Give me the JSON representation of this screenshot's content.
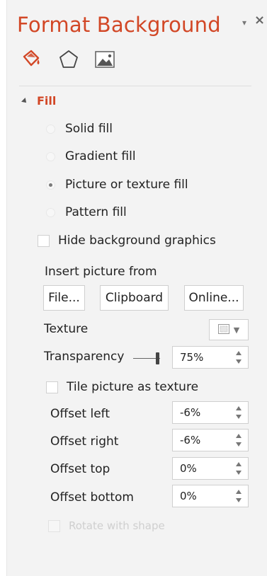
{
  "pane": {
    "title": "Format Background",
    "pin_glyph": "▾",
    "close_glyph": "×"
  },
  "tabs": [
    {
      "name": "Fill",
      "icon": "paint-bucket-icon"
    },
    {
      "name": "Effects",
      "icon": "pentagon-icon"
    },
    {
      "name": "Picture",
      "icon": "picture-icon"
    }
  ],
  "fill_section": {
    "header": "Fill",
    "options": [
      {
        "label": "Solid fill",
        "checked": false
      },
      {
        "label": "Gradient fill",
        "checked": false
      },
      {
        "label": "Picture or texture fill",
        "checked": true
      },
      {
        "label": "Pattern fill",
        "checked": false
      }
    ],
    "hide_background_graphics": {
      "label": "Hide background graphics",
      "checked": false
    }
  },
  "insert_picture": {
    "label": "Insert picture from",
    "buttons": [
      "File...",
      "Clipboard",
      "Online..."
    ]
  },
  "texture": {
    "label": "Texture"
  },
  "transparency": {
    "label": "Transparency",
    "value": "75%",
    "level": 0.75
  },
  "tile": {
    "label": "Tile picture as texture",
    "checked": false
  },
  "offsets": [
    {
      "label": "Offset left",
      "value": "-6%"
    },
    {
      "label": "Offset right",
      "value": "-6%"
    },
    {
      "label": "Offset top",
      "value": "0%"
    },
    {
      "label": "Offset bottom",
      "value": "0%"
    }
  ],
  "rotate": {
    "label": "Rotate with shape",
    "checked": false,
    "disabled": true
  },
  "colors": {
    "accent": "#d24726",
    "pane_background": "#f3f3f3"
  }
}
